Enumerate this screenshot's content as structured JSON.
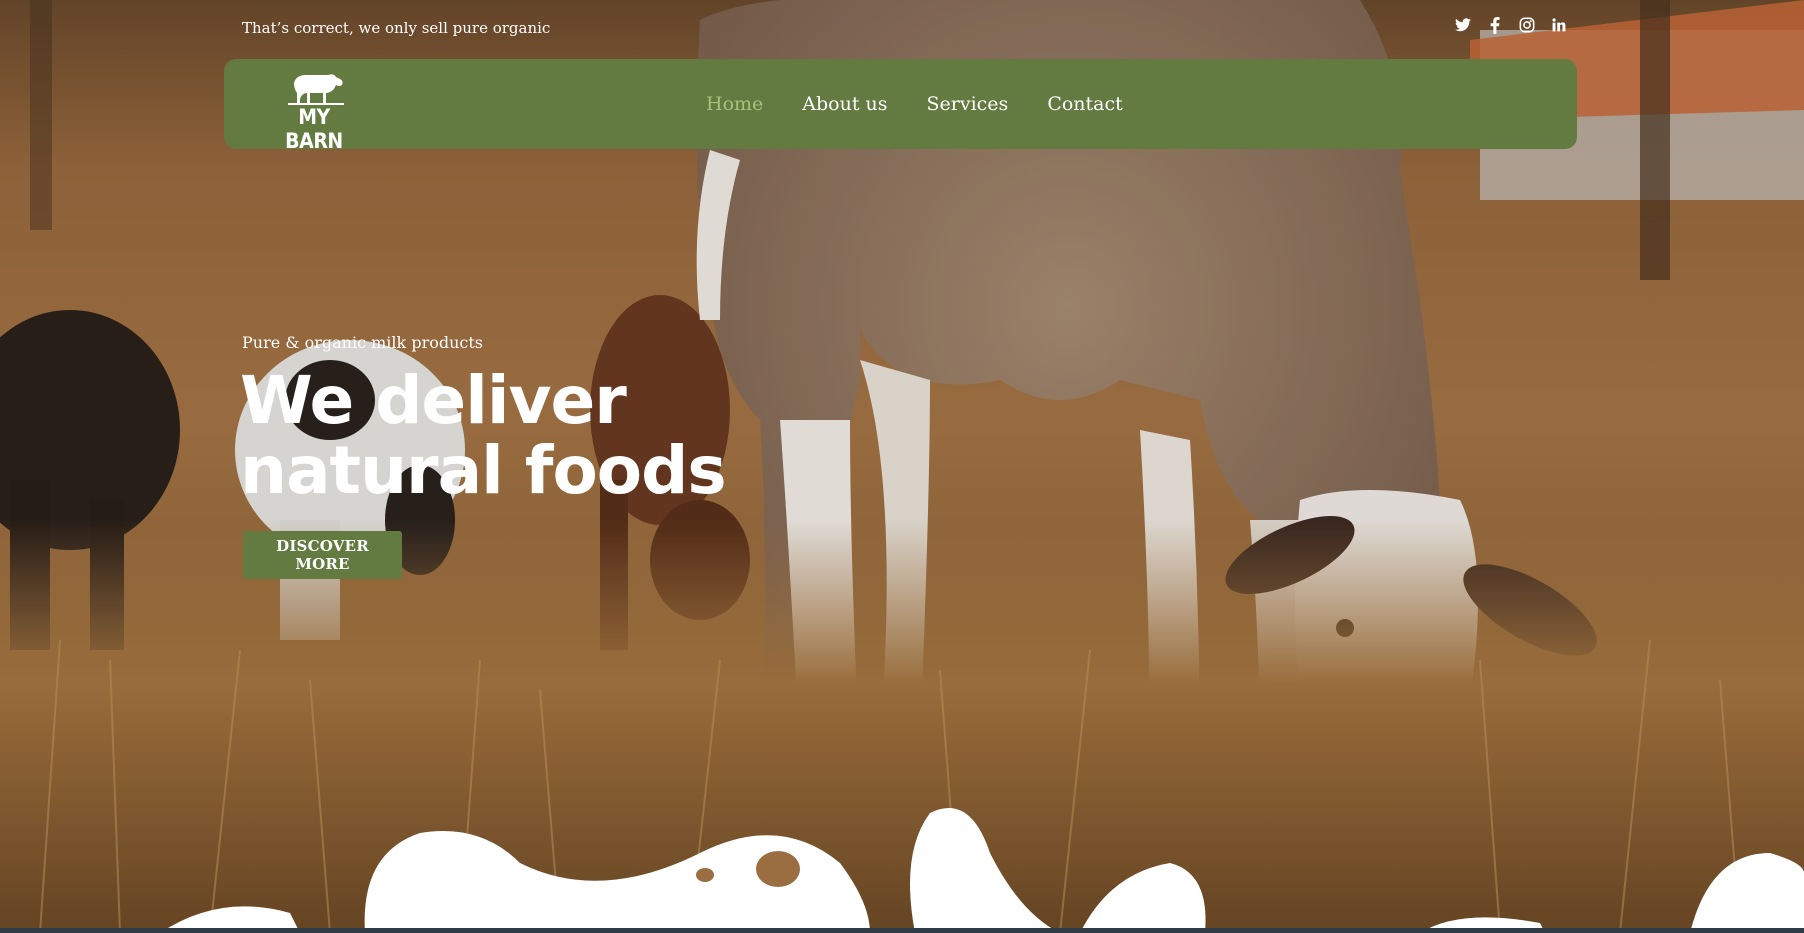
{
  "topbar": {
    "tagline": "That’s correct, we only sell pure organic",
    "social_icons": [
      "twitter-icon",
      "facebook-icon",
      "instagram-icon",
      "linkedin-icon"
    ]
  },
  "navbar": {
    "logo_text": "MY BARN",
    "links": [
      {
        "label": "Home",
        "active": true
      },
      {
        "label": "About us",
        "active": false
      },
      {
        "label": "Services",
        "active": false
      },
      {
        "label": "Contact",
        "active": false
      }
    ]
  },
  "hero": {
    "eyebrow": "Pure & organic milk products",
    "title_line1": "We deliver",
    "title_line2": "natural foods",
    "cta_label": "DISCOVER MORE"
  },
  "colors": {
    "brand_green": "#637a40",
    "active_link": "#a7c27a",
    "text_light": "#ffffff"
  }
}
